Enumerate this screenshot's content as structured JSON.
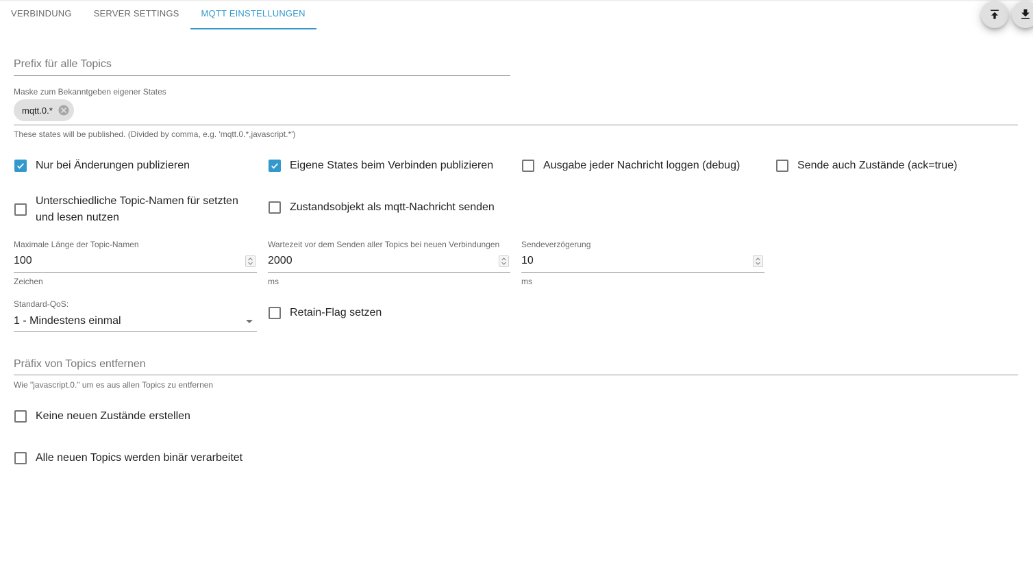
{
  "tabs": [
    {
      "label": "VERBINDUNG"
    },
    {
      "label": "SERVER SETTINGS"
    },
    {
      "label": "MQTT EINSTELLUNGEN"
    }
  ],
  "toolbar": {
    "upload_icon": "upload-to-top-icon",
    "download_icon": "download-icon"
  },
  "colors": {
    "accent": "#3399cc",
    "chip_bg": "#e0e0e0"
  },
  "prefix": {
    "placeholder": "Prefix für alle Topics",
    "value": ""
  },
  "mask": {
    "label": "Maske zum Bekanntgeben eigener States",
    "chips": [
      "mqtt.0.*"
    ],
    "helper": "These states will be published. (Divided by comma, e.g. 'mqtt.0.*,javascript.*')"
  },
  "checkboxes": {
    "only_changes": {
      "label": "Nur bei Änderungen publizieren",
      "checked": true
    },
    "publish_own_states": {
      "label": "Eigene States beim Verbinden publizieren",
      "checked": true
    },
    "log_debug": {
      "label": "Ausgabe jeder Nachricht loggen (debug)",
      "checked": false
    },
    "send_ack": {
      "label": "Sende auch Zustände (ack=true)",
      "checked": false
    },
    "different_topics_line1": "Unterschiedliche Topic-Namen für setzten",
    "different_topics_line2": "und lesen nutzen",
    "different_topics_checked": false,
    "state_object": {
      "label": "Zustandsobjekt als mqtt-Nachricht senden",
      "checked": false
    },
    "retain": {
      "label": "Retain-Flag setzen",
      "checked": false
    },
    "no_new_states": {
      "label": "Keine neuen Zustände erstellen",
      "checked": false
    },
    "binary": {
      "label": "Alle neuen Topics werden binär verarbeitet",
      "checked": false
    }
  },
  "numbers": {
    "max_topic_length": {
      "label": "Maximale Länge der Topic-Namen",
      "value": "100",
      "unit": "Zeichen"
    },
    "wait_time": {
      "label": "Wartezeit vor dem Senden aller Topics bei neuen Verbindungen",
      "value": "2000",
      "unit": "ms"
    },
    "send_delay": {
      "label": "Sendeverzögerung",
      "value": "10",
      "unit": "ms"
    }
  },
  "qos": {
    "label": "Standard-QoS:",
    "value": "1 - Mindestens einmal"
  },
  "remove_prefix": {
    "placeholder": "Präfix von Topics entfernen",
    "value": "",
    "helper": "Wie \"javascript.0.\" um es aus allen Topics zu entfernen"
  }
}
